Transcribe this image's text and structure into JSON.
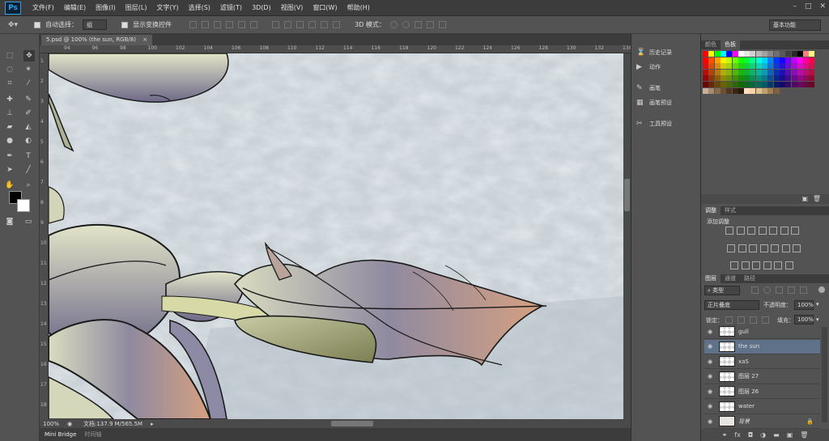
{
  "app": {
    "logo": "Ps"
  },
  "menu": [
    "文件(F)",
    "编辑(E)",
    "图像(I)",
    "图层(L)",
    "文字(Y)",
    "选择(S)",
    "滤镜(T)",
    "3D(D)",
    "视图(V)",
    "窗口(W)",
    "帮助(H)"
  ],
  "window_controls": {
    "minimize": "–",
    "restore": "□",
    "close": "✕"
  },
  "options": {
    "auto_select_label": "自动选择：",
    "auto_select_value": "组",
    "show_transform_label": "显示变换控件",
    "mode_3d_label": "3D 模式：",
    "workspace": "基本功能"
  },
  "document": {
    "tab_title": "5.psd @ 100% (the sun, RGB/8)",
    "tab_close": "×",
    "zoom": "100%",
    "doc_size": "文档:137.9 M/565.5M"
  },
  "ruler": {
    "top_ticks": [
      "94",
      "96",
      "98",
      "100",
      "102",
      "104",
      "106",
      "108",
      "110",
      "112",
      "114",
      "116",
      "118",
      "120",
      "122",
      "124",
      "126",
      "128",
      "130",
      "132",
      "134"
    ],
    "left_ticks": [
      "1",
      "2",
      "3",
      "4",
      "5",
      "6",
      "7",
      "8",
      "9",
      "10",
      "11",
      "12",
      "13",
      "14",
      "15",
      "16",
      "17",
      "18"
    ]
  },
  "bottom_tabs": [
    "Mini Bridge",
    "时间轴"
  ],
  "dock": {
    "items": [
      {
        "icon": "history-icon",
        "label": "历史记录"
      },
      {
        "icon": "actions-icon",
        "label": "动作"
      },
      {
        "icon": "brush-icon",
        "label": "画笔"
      },
      {
        "icon": "brush-presets-icon",
        "label": "画笔预设"
      },
      {
        "icon": "tool-presets-icon",
        "label": "工具预设"
      }
    ]
  },
  "swatches_panel": {
    "tabs": [
      "颜色",
      "色板"
    ]
  },
  "adjustments_panel": {
    "tabs": [
      "调整",
      "样式"
    ],
    "title": "添加调整"
  },
  "layers_panel": {
    "tabs": [
      "图层",
      "通道",
      "路径"
    ],
    "filter_kind": "类型",
    "blend_mode": "正片叠底",
    "opacity_label": "不透明度：",
    "opacity_value": "100%",
    "lock_label": "锁定：",
    "fill_label": "填充：",
    "fill_value": "100%",
    "layers": [
      {
        "name": "gull",
        "selected": false
      },
      {
        "name": "the sun",
        "selected": true
      },
      {
        "name": "xaS",
        "selected": false
      },
      {
        "name": "图层 27",
        "selected": false
      },
      {
        "name": "图层 26",
        "selected": false
      },
      {
        "name": "water",
        "selected": false
      },
      {
        "name": "背景",
        "selected": false
      }
    ]
  },
  "colors": {
    "accent": "#2aa3e6",
    "selected_layer": "#5f728a",
    "panel_bg": "#535353"
  }
}
